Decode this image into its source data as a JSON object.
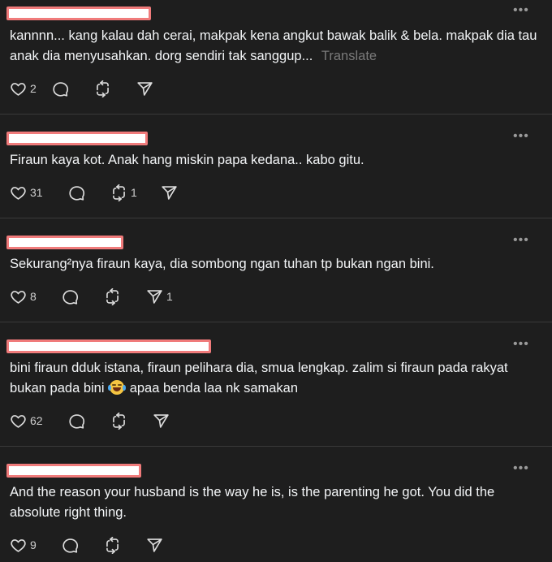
{
  "icons": {
    "like": "heart-icon",
    "comment": "comment-bubble-icon",
    "repost": "repost-icon",
    "share": "send-icon",
    "more": "more-horizontal-icon"
  },
  "posts": [
    {
      "more": "•••",
      "text": "kannnn... kang kalau dah cerai, makpak kena angkut bawak balik & bela. makpak dia tau anak dia menyusahkan. dorg sendiri tak sanggup...",
      "translate": "Translate",
      "likes": "2",
      "replies": "",
      "reposts": "",
      "shares": ""
    },
    {
      "more": "•••",
      "text": "Firaun kaya kot. Anak hang miskin papa kedana.. kabo gitu.",
      "likes": "31",
      "replies": "",
      "reposts": "1",
      "shares": ""
    },
    {
      "more": "•••",
      "text": "Sekurang²nya firaun kaya, dia sombong ngan tuhan tp bukan ngan bini.",
      "likes": "8",
      "replies": "",
      "reposts": "",
      "shares": "1"
    },
    {
      "more": "•••",
      "text_before_emoji": "bini firaun dduk istana, firaun pelihara dia, smua lengkap. zalim si firaun pada rakyat bukan pada bini",
      "emoji": "face-with-tears-of-joy",
      "text_after_emoji": "apaa benda laa nk samakan",
      "likes": "62",
      "replies": "",
      "reposts": "",
      "shares": ""
    },
    {
      "more": "•••",
      "text": "And the reason your husband is the way he is, is the parenting he got. You did the absolute right thing.",
      "likes": "9",
      "replies": "",
      "reposts": "",
      "shares": ""
    }
  ]
}
